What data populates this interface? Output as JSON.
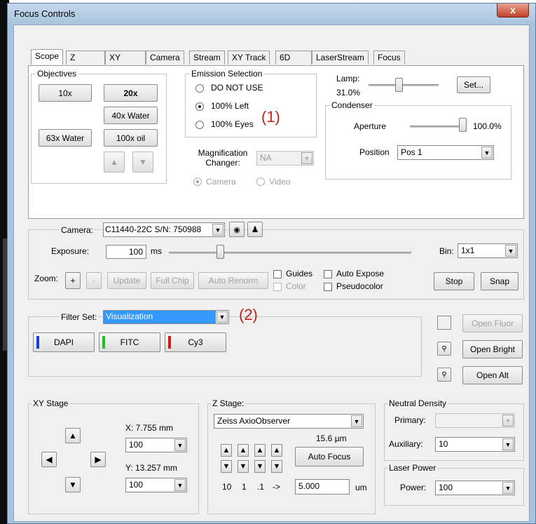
{
  "window": {
    "title": "Focus Controls",
    "close_label": "x"
  },
  "tabs": [
    "Scope",
    "Z",
    "XY",
    "Camera",
    "Stream",
    "XY Track",
    "6D",
    "LaserStream",
    "Focus"
  ],
  "objectives": {
    "label": "Objectives",
    "buttons": [
      "10x",
      "20x",
      "40x Water",
      "63x Water",
      "100x oil"
    ]
  },
  "emission": {
    "label": "Emission Selection",
    "options": [
      "DO NOT USE",
      "100% Left",
      "100% Eyes"
    ],
    "selected": "100% Left"
  },
  "annotation1": "(1)",
  "annotation2": "(2)",
  "magnification": {
    "label_line1": "Magnification",
    "label_line2": "Changer:",
    "value": "NA",
    "camera": "Camera",
    "video": "Video"
  },
  "lamp": {
    "label": "Lamp:",
    "value": "31.0%",
    "set_label": "Set..."
  },
  "condenser": {
    "label": "Condenser",
    "aperture_label": "Aperture",
    "aperture_value": "100.0%",
    "position_label": "Position",
    "position_value": "Pos 1"
  },
  "camera": {
    "label": "Camera:",
    "value": "C11440-22C S/N: 750988",
    "exposure_label": "Exposure:",
    "exposure_value": "100",
    "exposure_unit": "ms",
    "bin_label": "Bin:",
    "bin_value": "1x1",
    "zoom_label": "Zoom:",
    "zoom_plus": "+",
    "zoom_minus": "-",
    "update": "Update",
    "full_chip": "Full Chip",
    "auto_renorm": "Auto Renorm",
    "guides": "Guides",
    "auto_expose": "Auto Expose",
    "color": "Color",
    "pseudocolor": "Pseudocolor",
    "stop": "Stop",
    "snap": "Snap"
  },
  "filter": {
    "label": "Filter Set:",
    "value": "Visualization",
    "buttons": [
      {
        "label": "DAPI",
        "color": "#1a3fd6"
      },
      {
        "label": "FITC",
        "color": "#1ec21e"
      },
      {
        "label": "Cy3",
        "color": "#d01c1c"
      }
    ],
    "open_fluor": "Open Fluor",
    "open_bright": "Open Bright",
    "open_alt": "Open Alt"
  },
  "xy_stage": {
    "label": "XY Stage",
    "x_label": "X: 7.755 mm",
    "y_label": "Y: 13.257 mm",
    "x_step": "100",
    "y_step": "100"
  },
  "z_stage": {
    "label": "Z Stage:",
    "drive": "Zeiss AxioObserver",
    "position": "15.6 µm",
    "auto_focus": "Auto Focus",
    "steps": [
      "10",
      "1",
      ".1",
      "->"
    ],
    "step_value": "5.000",
    "unit": "um"
  },
  "neutral_density": {
    "label": "Neutral Density",
    "primary_label": "Primary:",
    "auxiliary_label": "Auxiliary:",
    "auxiliary_value": "10"
  },
  "laser_power": {
    "label": "Laser Power",
    "power_label": "Power:",
    "power_value": "100"
  }
}
